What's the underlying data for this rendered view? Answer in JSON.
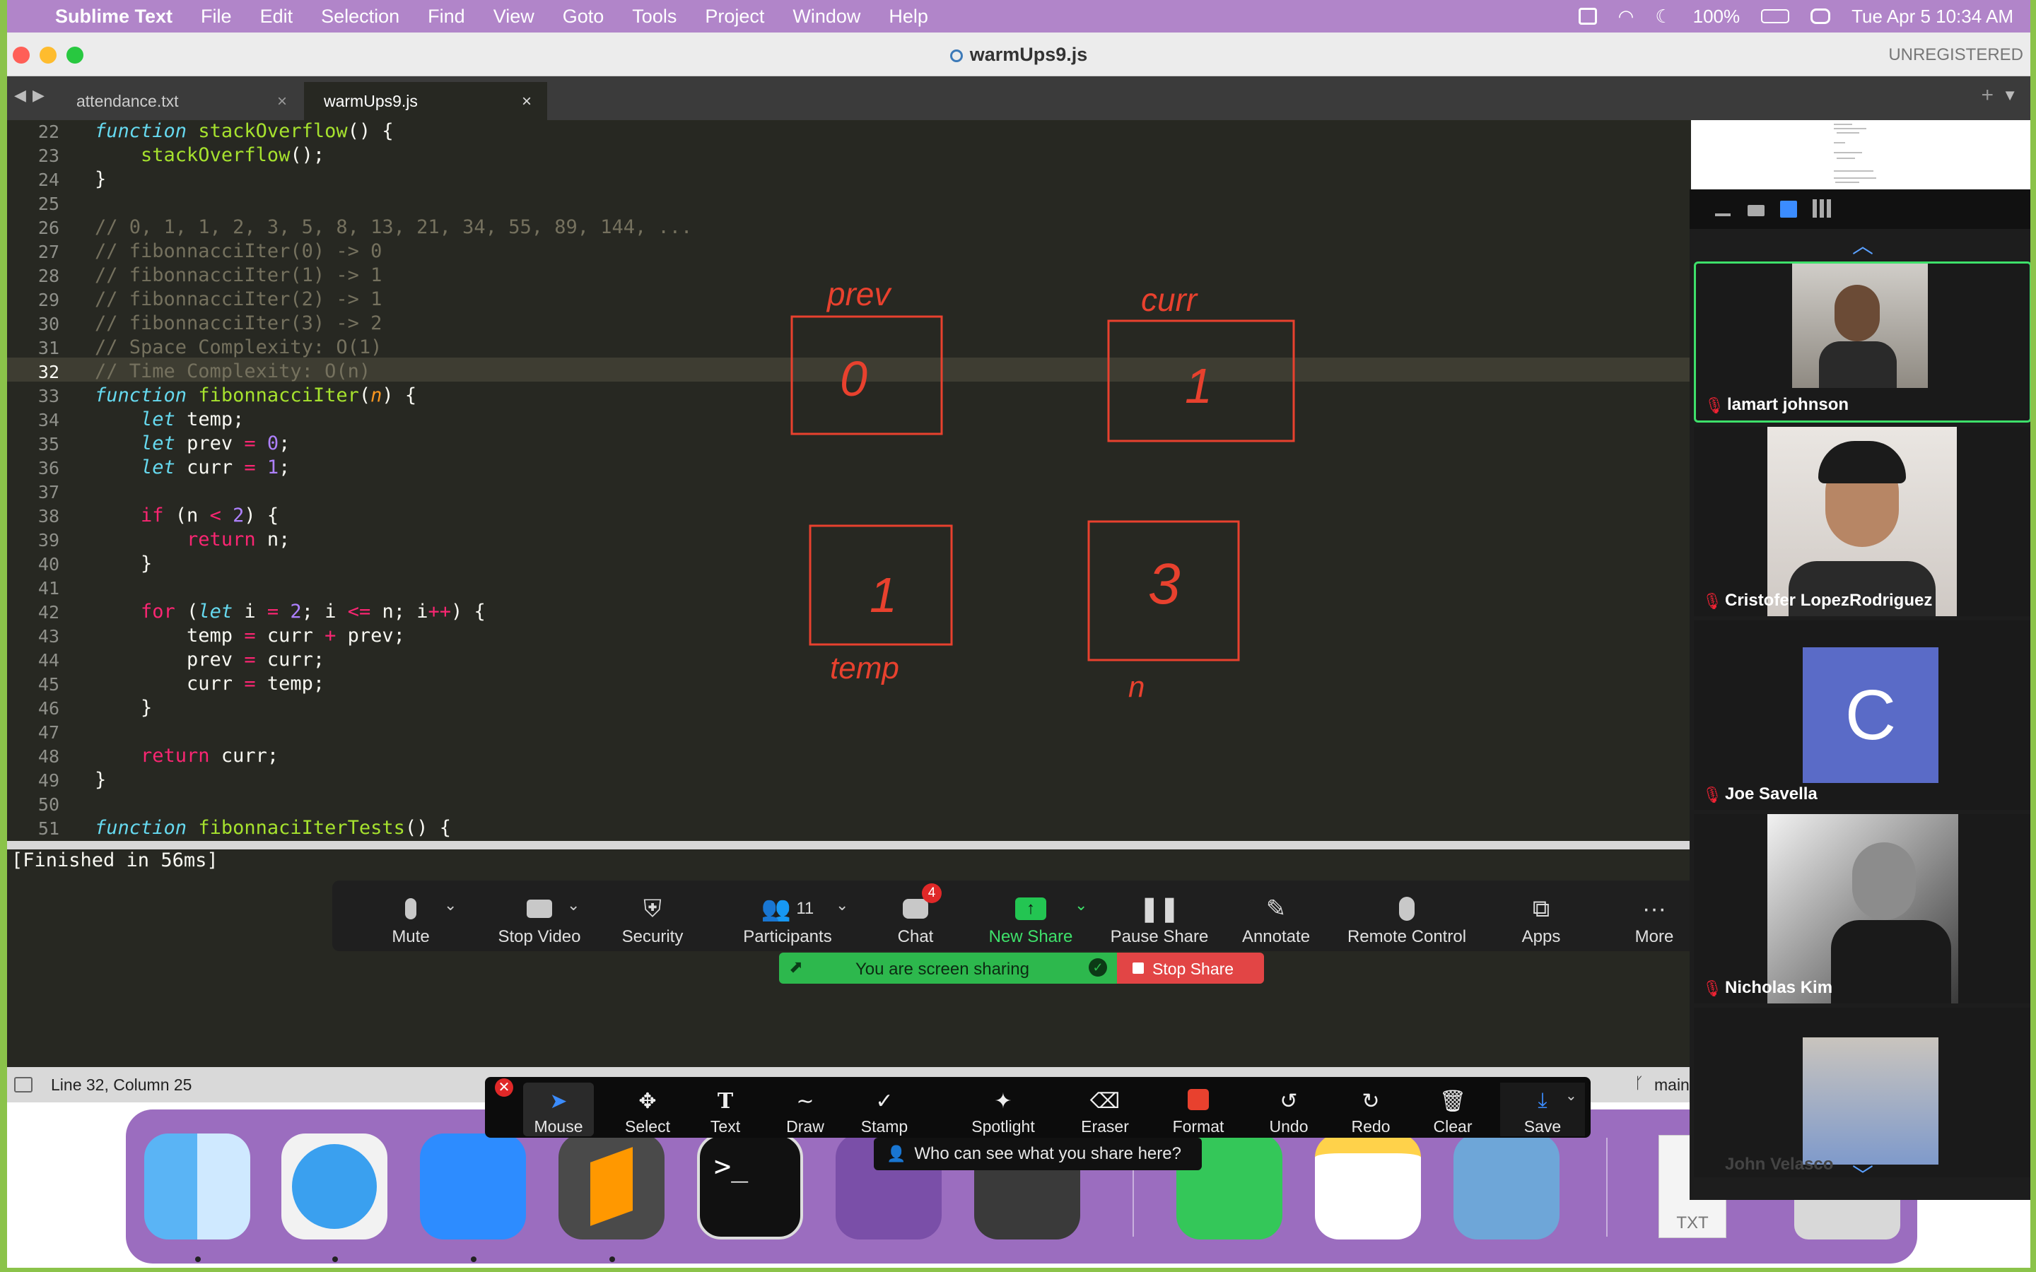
{
  "menubar": {
    "app": "Sublime Text",
    "items": [
      "File",
      "Edit",
      "Selection",
      "Find",
      "View",
      "Goto",
      "Tools",
      "Project",
      "Window",
      "Help"
    ],
    "battery": "100%",
    "datetime": "Tue Apr 5  10:34 AM"
  },
  "window": {
    "title": "warmUps9.js",
    "unregistered": "UNREGISTERED"
  },
  "tabs": [
    {
      "label": "attendance.txt"
    },
    {
      "label": "warmUps9.js"
    }
  ],
  "code": {
    "line_numbers": [
      "22",
      "23",
      "24",
      "25",
      "26",
      "27",
      "28",
      "29",
      "30",
      "31",
      "32",
      "33",
      "34",
      "35",
      "36",
      "37",
      "38",
      "39",
      "40",
      "41",
      "42",
      "43",
      "44",
      "45",
      "46",
      "47",
      "48",
      "49",
      "50",
      "51"
    ],
    "current_line": "32"
  },
  "console": {
    "output": "[Finished in 56ms]"
  },
  "statusbar": {
    "position": "Line 32, Column 25",
    "branch": "main"
  },
  "drawing": {
    "labels": [
      "prev",
      "curr",
      "temp",
      "n"
    ],
    "values": [
      "0",
      "1",
      "1",
      "3"
    ],
    "ink_color": "#e8412e"
  },
  "zoom_toolbar": {
    "mute": "Mute",
    "stop_video": "Stop Video",
    "security": "Security",
    "participants": "Participants",
    "participants_count": "11",
    "chat": "Chat",
    "chat_badge": "4",
    "new_share": "New Share",
    "pause_share": "Pause Share",
    "annotate": "Annotate",
    "remote_control": "Remote Control",
    "apps": "Apps",
    "more": "More"
  },
  "share_banner": {
    "text": "You are screen sharing",
    "stop": "Stop Share"
  },
  "annotate_toolbar": {
    "mouse": "Mouse",
    "select": "Select",
    "text": "Text",
    "draw": "Draw",
    "stamp": "Stamp",
    "spotlight": "Spotlight",
    "eraser": "Eraser",
    "format": "Format",
    "undo": "Undo",
    "redo": "Redo",
    "clear": "Clear",
    "save": "Save",
    "who_can_see": "Who can see what you share here?"
  },
  "participants": [
    {
      "name": "lamart johnson"
    },
    {
      "name": "Cristofer LopezRodriguez"
    },
    {
      "name": "Joe Savella",
      "initial": "C"
    },
    {
      "name": "Nicholas Kim"
    },
    {
      "name": "John Velasco"
    }
  ],
  "dock": {
    "txt_label": "TXT"
  }
}
